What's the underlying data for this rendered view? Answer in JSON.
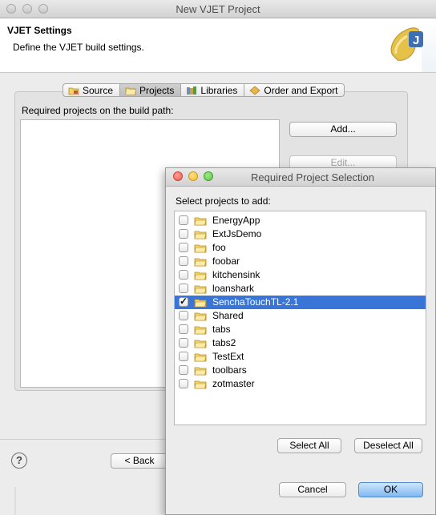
{
  "main_window": {
    "title": "New VJET Project",
    "header_title": "VJET Settings",
    "header_desc": "Define the VJET build settings.",
    "tabs": [
      {
        "label": "Source",
        "icon": "source-folder-icon"
      },
      {
        "label": "Projects",
        "icon": "projects-icon",
        "active": true
      },
      {
        "label": "Libraries",
        "icon": "libraries-icon"
      },
      {
        "label": "Order and Export",
        "icon": "order-export-icon"
      }
    ],
    "panel_label": "Required projects on the build path:",
    "add_button": "Add...",
    "edit_button": "Edit...",
    "back_button": "< Back",
    "help_glyph": "?"
  },
  "dialog": {
    "title": "Required Project Selection",
    "label": "Select projects to add:",
    "projects": [
      {
        "name": "EnergyApp",
        "checked": false
      },
      {
        "name": "ExtJsDemo",
        "checked": false
      },
      {
        "name": "foo",
        "checked": false
      },
      {
        "name": "foobar",
        "checked": false
      },
      {
        "name": "kitchensink",
        "checked": false
      },
      {
        "name": "loanshark",
        "checked": false
      },
      {
        "name": "SenchaTouchTL-2.1",
        "checked": true,
        "selected": true
      },
      {
        "name": "Shared",
        "checked": false
      },
      {
        "name": "tabs",
        "checked": false
      },
      {
        "name": "tabs2",
        "checked": false
      },
      {
        "name": "TestExt",
        "checked": false
      },
      {
        "name": "toolbars",
        "checked": false
      },
      {
        "name": "zotmaster",
        "checked": false
      }
    ],
    "select_all": "Select All",
    "deselect_all": "Deselect All",
    "cancel": "Cancel",
    "ok": "OK"
  },
  "colors": {
    "selection": "#3875d7",
    "ok_button": "#7fb8f0",
    "close_red": "#ee5d52",
    "minimize_yellow": "#f3bc2e",
    "zoom_green": "#5fc63f"
  }
}
